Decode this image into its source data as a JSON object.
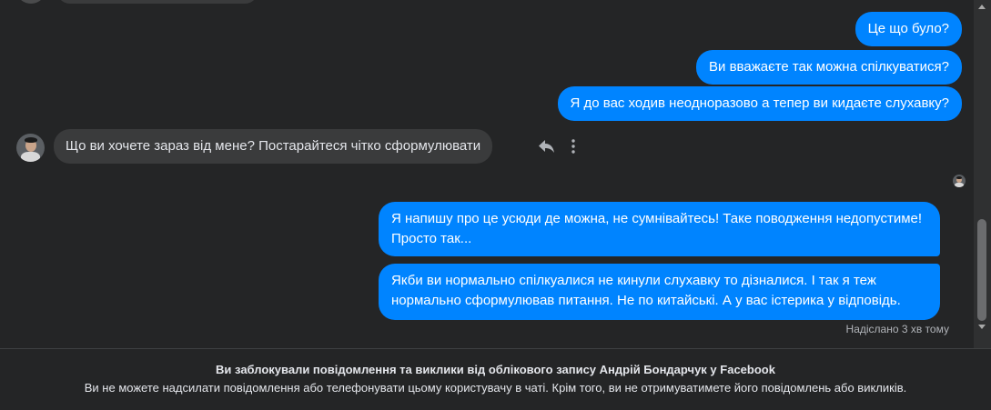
{
  "conversation": {
    "contact_name": "Андрій Бондарчук",
    "messages": [
      {
        "id": "m1",
        "direction": "outgoing",
        "text": "Це що було?"
      },
      {
        "id": "m2",
        "direction": "outgoing",
        "text": "Ви вважаєте так можна спілкуватися?"
      },
      {
        "id": "m3",
        "direction": "outgoing",
        "text": "Я до вас ходив неодноразово а тепер ви кидаєте слухавку?"
      },
      {
        "id": "m4",
        "direction": "incoming",
        "text": "Що ви хочете зараз від мене? Постарайтеся чітко сформулювати"
      },
      {
        "id": "m5",
        "direction": "outgoing",
        "text": "Я напишу про це усюди де можна, не сумнівайтесь! Таке поводження недопустиме! Просто так..."
      },
      {
        "id": "m6",
        "direction": "outgoing",
        "text": "Якби ви нормально спілкуалися не кинули слухавку то дізналися. І так я теж нормально сформулював питання. Не по китайські. А у вас істерика у відповідь."
      }
    ],
    "sent_status": "Надіслано 3 хв тому",
    "icons": {
      "reply": "reply-icon",
      "more": "more-vertical-icon",
      "seen": "seen-avatar-icon"
    }
  },
  "footer": {
    "title": "Ви заблокували повідомлення та виклики від облікового запису Андрій Бондарчук у Facebook",
    "text": "Ви не можете надсилати повідомлення або телефонувати цьому користувачу в чаті. Крім того, ви не отримуватимете його повідомлень або викликів."
  },
  "colors": {
    "background": "#242526",
    "outgoing_bubble": "#0084ff",
    "incoming_bubble": "#3a3b3c",
    "text_primary": "#e4e6eb",
    "text_secondary": "#b0b3b8"
  }
}
